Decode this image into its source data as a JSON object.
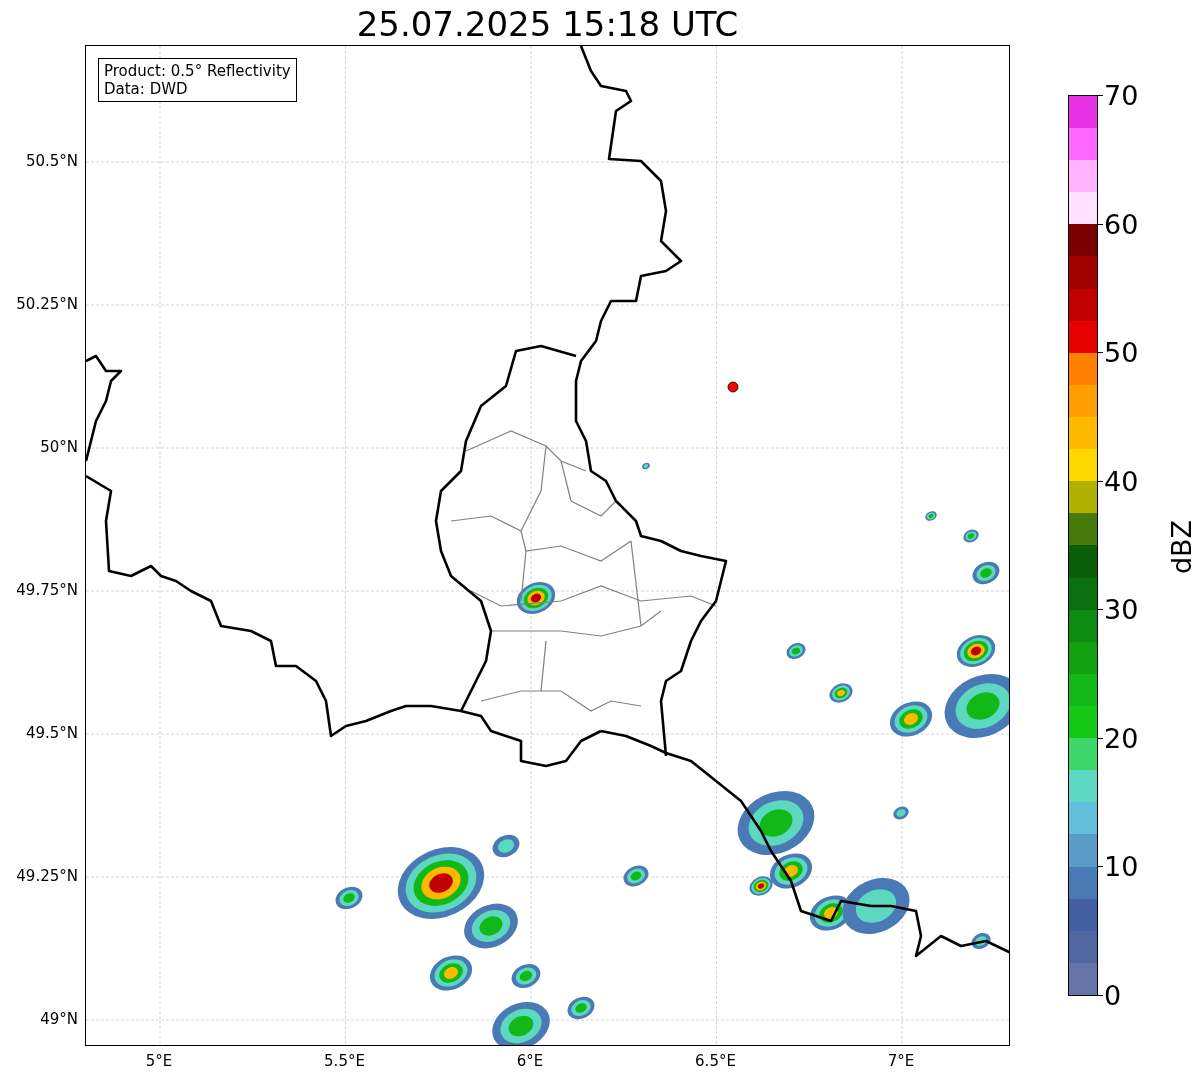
{
  "title": "25.07.2025 15:18 UTC",
  "legend": {
    "lines": [
      "Product: 0.5° Reflectivity",
      "Data: DWD"
    ]
  },
  "axes": {
    "y_ticks": [
      "50.5°N",
      "50.25°N",
      "50°N",
      "49.75°N",
      "49.5°N",
      "49.25°N",
      "49°N"
    ],
    "x_ticks": [
      "5°E",
      "5.5°E",
      "6°E",
      "6.5°E",
      "7°E"
    ]
  },
  "colorbar": {
    "label": "dBZ",
    "ticks": [
      "70",
      "60",
      "50",
      "40",
      "30",
      "20",
      "10",
      "0"
    ],
    "segments": [
      {
        "color": "#6674a8"
      },
      {
        "color": "#50669e"
      },
      {
        "color": "#425fa3"
      },
      {
        "color": "#4a7ab5"
      },
      {
        "color": "#5a9ec8"
      },
      {
        "color": "#63c0dc"
      },
      {
        "color": "#5dd8c0"
      },
      {
        "color": "#3cd66a"
      },
      {
        "color": "#14c814"
      },
      {
        "color": "#12b818"
      },
      {
        "color": "#10a010"
      },
      {
        "color": "#0d8a10"
      },
      {
        "color": "#0b7010"
      },
      {
        "color": "#0a5e0a"
      },
      {
        "color": "#467a0a"
      },
      {
        "color": "#b0b000"
      },
      {
        "color": "#ffd800"
      },
      {
        "color": "#ffba00"
      },
      {
        "color": "#ff9e00"
      },
      {
        "color": "#ff8000"
      },
      {
        "color": "#e60000"
      },
      {
        "color": "#c00000"
      },
      {
        "color": "#a00000"
      },
      {
        "color": "#7a0000"
      },
      {
        "color": "#ffe0ff"
      },
      {
        "color": "#ffb3ff"
      },
      {
        "color": "#ff66ff"
      },
      {
        "color": "#e832e8"
      }
    ]
  }
}
